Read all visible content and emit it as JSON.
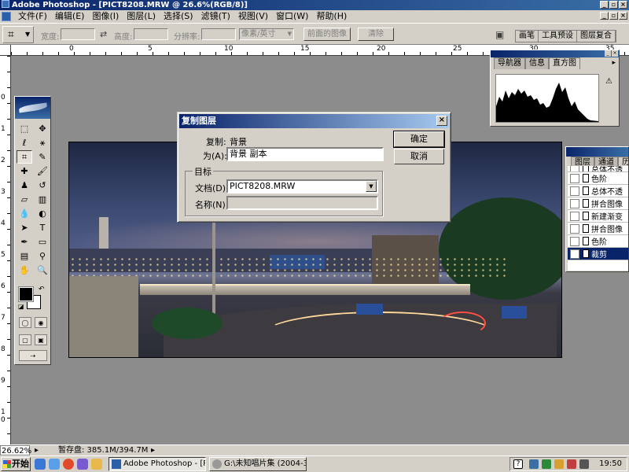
{
  "app": {
    "title": "Adobe Photoshop - [PICT8208.MRW @ 26.6%(RGB/8)]"
  },
  "menu": [
    "文件(F)",
    "编辑(E)",
    "图像(I)",
    "图层(L)",
    "选择(S)",
    "滤镜(T)",
    "视图(V)",
    "窗口(W)",
    "帮助(H)"
  ],
  "options": {
    "width_label": "宽度:",
    "height_label": "高度:",
    "resolution_label": "分辨率:",
    "unit_value": "像素/英寸",
    "front_image_label": "前面的图像",
    "clear_label": "清除",
    "well_tabs": [
      "画笔",
      "工具预设",
      "图层复合"
    ]
  },
  "rulers": {
    "top": [
      "0",
      "5",
      "10",
      "15",
      "20",
      "25",
      "30",
      "35"
    ],
    "left": [
      "0",
      "1",
      "2",
      "3",
      "4",
      "5",
      "6",
      "7",
      "8",
      "9",
      "1",
      "0"
    ]
  },
  "dialog": {
    "title": "复制图层",
    "duplicate_label": "复制:",
    "duplicate_value": "背景",
    "as_label": "为(A):",
    "as_value": "背景 副本",
    "target_group": "目标",
    "document_label": "文档(D):",
    "document_value": "PICT8208.MRW",
    "name_label": "名称(N):",
    "name_value": "",
    "ok_label": "确定",
    "cancel_label": "取消"
  },
  "navigator": {
    "tabs": [
      "导航器",
      "信息",
      "直方图"
    ],
    "warning": "⚠"
  },
  "history": {
    "tabs": [
      "图层",
      "通道",
      "历"
    ],
    "items": [
      "总体不透",
      "色阶",
      "总体不透",
      "拼合图像",
      "新建渐变",
      "拼合图像",
      "色阶",
      "裁剪"
    ]
  },
  "status": {
    "zoom": "26.62%",
    "scratch": "暂存盘: 385.1M/394.7M"
  },
  "taskbar": {
    "start_label": "开始",
    "tasks": [
      "Adobe Photoshop - [PIC...",
      "G:\\未知唱片集 (2004-3-..."
    ],
    "clock": "19:50"
  }
}
